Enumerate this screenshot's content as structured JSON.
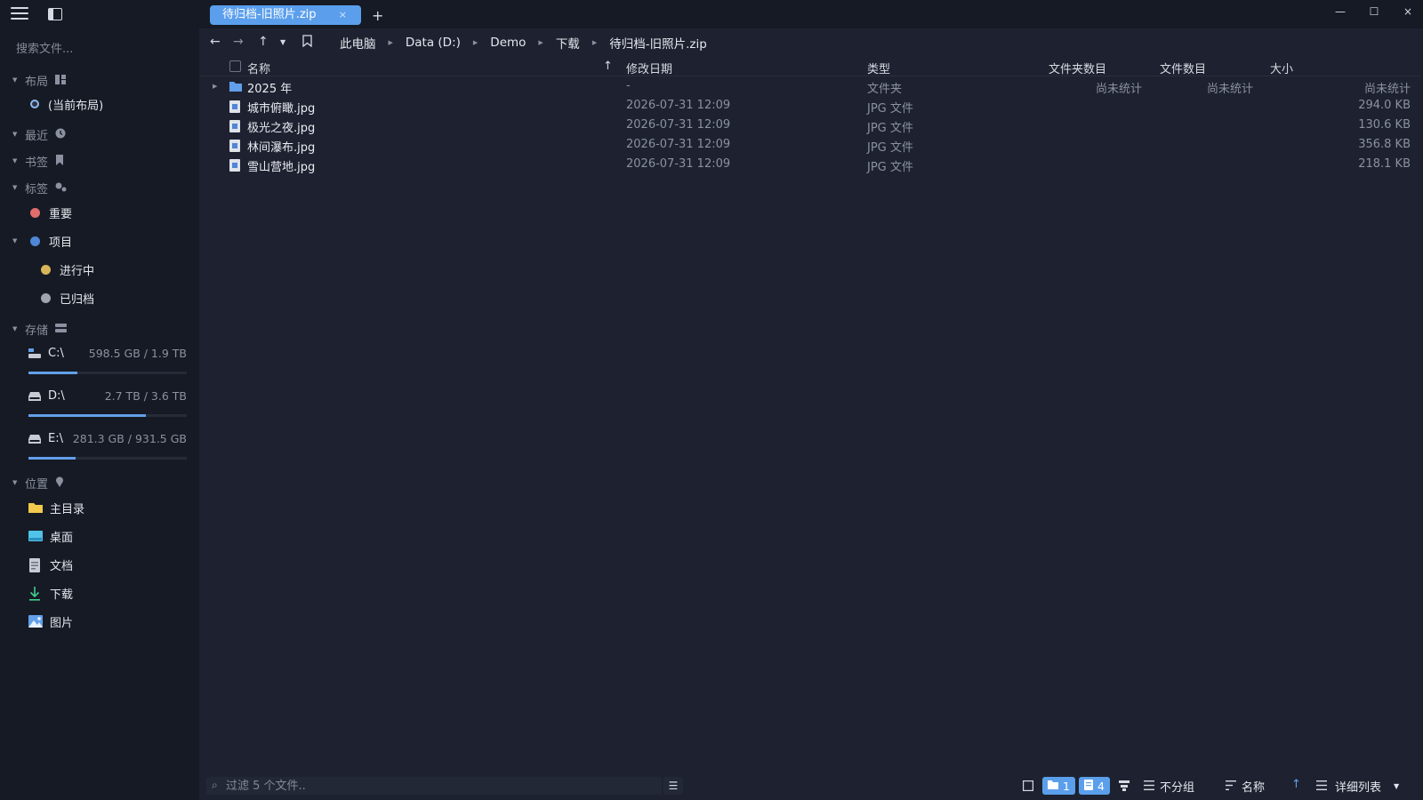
{
  "sidebar": {
    "search_placeholder": "搜索文件...",
    "sections": {
      "layout": "布局",
      "recent": "最近",
      "bookmarks": "书签",
      "tags": "标签",
      "storage": "存储",
      "locations": "位置"
    },
    "layout_current": "(当前布局)",
    "tags": [
      {
        "label": "重要",
        "color": "#e06c6c"
      },
      {
        "label": "项目",
        "color": "#4f86d6"
      },
      {
        "label": "进行中",
        "color": "#d9b45a"
      },
      {
        "label": "已归档",
        "color": "#a0a4ad"
      }
    ],
    "drives": [
      {
        "name": "C:\\",
        "size": "598.5 GB / 1.9 TB",
        "usage": 0.31
      },
      {
        "name": "D:\\",
        "size": "2.7 TB / 3.6 TB",
        "usage": 0.74
      },
      {
        "name": "E:\\",
        "size": "281.3 GB / 931.5 GB",
        "usage": 0.3
      }
    ],
    "locations": [
      {
        "label": "主目录",
        "icon": "folder-icon"
      },
      {
        "label": "桌面",
        "icon": "desktop-icon"
      },
      {
        "label": "文档",
        "icon": "document-icon"
      },
      {
        "label": "下载",
        "icon": "download-icon"
      },
      {
        "label": "图片",
        "icon": "pictures-icon"
      }
    ]
  },
  "tabs": {
    "active_label": "待归档-旧照片.zip",
    "close": "×",
    "add": "+"
  },
  "window": {
    "minimize": "—",
    "maximize": "☐",
    "close": "×"
  },
  "breadcrumb": [
    "此电脑",
    "Data (D:)",
    "Demo",
    "下载",
    "待归档-旧照片.zip"
  ],
  "columns": {
    "name": "名称",
    "sort_indicator": "↑",
    "modified": "修改日期",
    "type": "类型",
    "folder_count": "文件夹数目",
    "file_count": "文件数目",
    "size": "大小"
  },
  "files": [
    {
      "name": "2025 年",
      "modified": "-",
      "type": "文件夹",
      "folder_count": "尚未统计",
      "file_count": "尚未统计",
      "size": "尚未统计",
      "kind": "folder"
    },
    {
      "name": "城市俯瞰.jpg",
      "modified": "2026-07-31 12:09",
      "type": "JPG 文件",
      "folder_count": "",
      "file_count": "",
      "size": "294.0 KB",
      "kind": "image"
    },
    {
      "name": "极光之夜.jpg",
      "modified": "2026-07-31 12:09",
      "type": "JPG 文件",
      "folder_count": "",
      "file_count": "",
      "size": "130.6 KB",
      "kind": "image"
    },
    {
      "name": "林间瀑布.jpg",
      "modified": "2026-07-31 12:09",
      "type": "JPG 文件",
      "folder_count": "",
      "file_count": "",
      "size": "356.8 KB",
      "kind": "image"
    },
    {
      "name": "雪山营地.jpg",
      "modified": "2026-07-31 12:09",
      "type": "JPG 文件",
      "folder_count": "",
      "file_count": "",
      "size": "218.1 KB",
      "kind": "image"
    }
  ],
  "statusbar": {
    "filter_placeholder": "过滤 5 个文件..",
    "folder_count": "1",
    "file_count": "4",
    "group_label": "不分组",
    "sort_label": "名称",
    "sort_dir": "↑",
    "view_label": "详细列表"
  },
  "colors": {
    "accent": "#5b9fec",
    "background": "#1e2230",
    "sidebar": "#161a24"
  }
}
